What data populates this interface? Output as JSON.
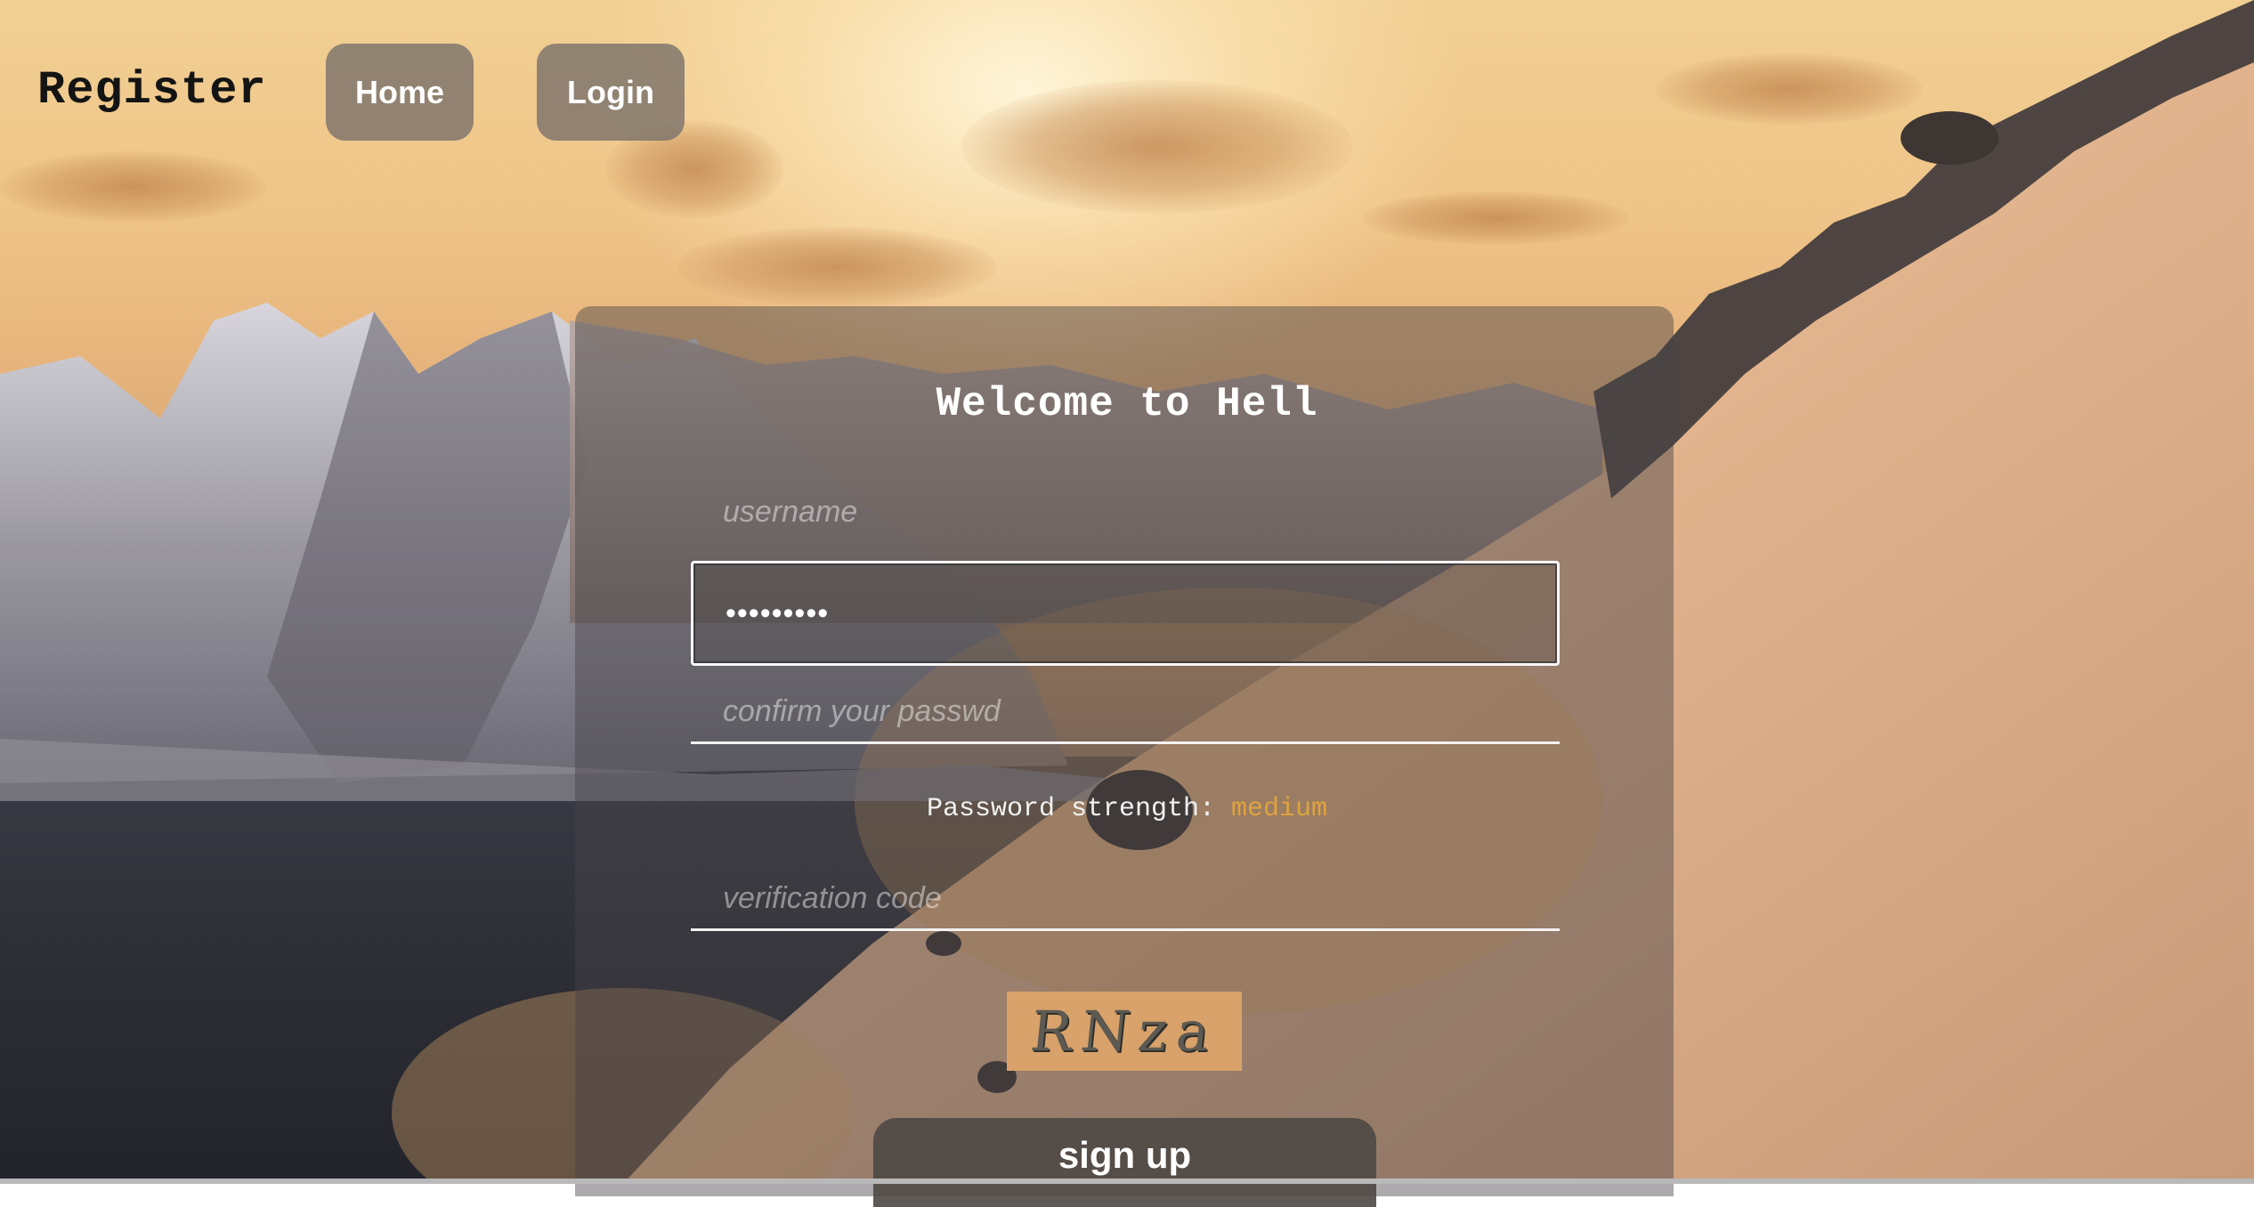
{
  "header": {
    "brand": "Register",
    "nav": [
      {
        "label": "Home"
      },
      {
        "label": "Login"
      }
    ]
  },
  "form": {
    "title": "Welcome to Hell",
    "username_placeholder": "username",
    "password_value": "•••••••••",
    "confirm_placeholder": "confirm your passwd",
    "strength_label": "Password strength:",
    "strength_value": "medium",
    "verification_placeholder": "verification code",
    "captcha_text": "RNza",
    "submit_label": "sign up"
  },
  "colors": {
    "strength_medium": "#e0a33e",
    "captcha_bg": "#d8a26a"
  },
  "icons": [
    "captcha-image"
  ]
}
